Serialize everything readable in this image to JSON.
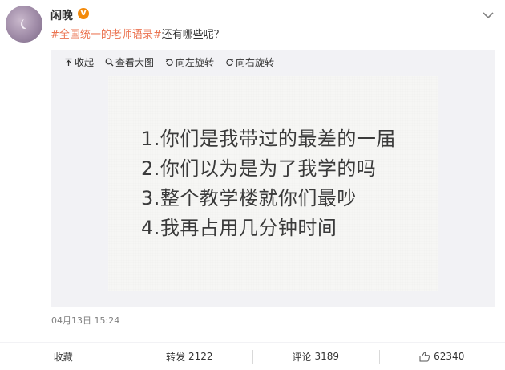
{
  "user": {
    "name": "闲晚",
    "badge": "V"
  },
  "post": {
    "hashtag": "#全国统一的老师语录#",
    "text": "还有哪些呢？",
    "timestamp": "04月13日 15:24"
  },
  "media_toolbar": {
    "collapse": "收起",
    "view_large": "查看大图",
    "rotate_left": "向左旋转",
    "rotate_right": "向右旋转"
  },
  "image_text": [
    "1.你们是我带过的最差的一届",
    "2.你们以为是为了我学的吗",
    "3.整个教学楼就你们最吵",
    "4.我再占用几分钟时间"
  ],
  "actions": {
    "favorite": "收藏",
    "repost_label": "转发",
    "repost_count": "2122",
    "comment_label": "评论",
    "comment_count": "3189",
    "like_count": "62340"
  },
  "colors": {
    "hashtag": "#eb7350",
    "badge": "#f38a0b",
    "media_bg": "#f2f2f5"
  },
  "icons": [
    "chevron-down-icon",
    "collapse-icon",
    "magnifier-icon",
    "rotate-left-icon",
    "rotate-right-icon",
    "thumbs-up-icon"
  ]
}
